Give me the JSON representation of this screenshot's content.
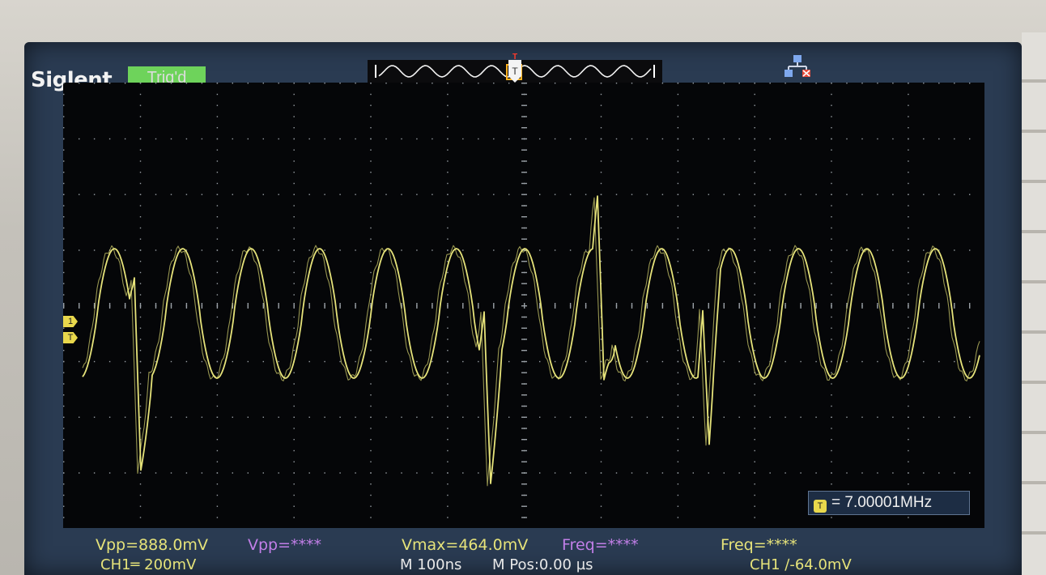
{
  "brand": "Siglent",
  "trigger_status": "Trig'd",
  "trigger_position_marker": "T",
  "channel_markers": [
    "1",
    "T"
  ],
  "frequency_counter": {
    "icon": "T",
    "value": "= 7.00001MHz"
  },
  "measurements": {
    "ch1_vpp": "Vpp=888.0mV",
    "ch2_vpp": "Vpp=****",
    "vmax": "Vmax=464.0mV",
    "ch2_freq": "Freq=****",
    "freq": "Freq=****"
  },
  "status_bar": {
    "ch1_scale": "CH1═ 200mV",
    "timebase": "M 100ns",
    "time_position": "M Pos:0.00 µs",
    "trigger_info": "CH1 ∕-64.0mV"
  },
  "colors": {
    "trace": "#e6e37a",
    "grid_dots": "#9aa0a6",
    "trigger_badge": "#6ed35b",
    "screen_frame": "#2a3b52"
  },
  "icons": {
    "network": "network-disconnected-icon"
  }
}
